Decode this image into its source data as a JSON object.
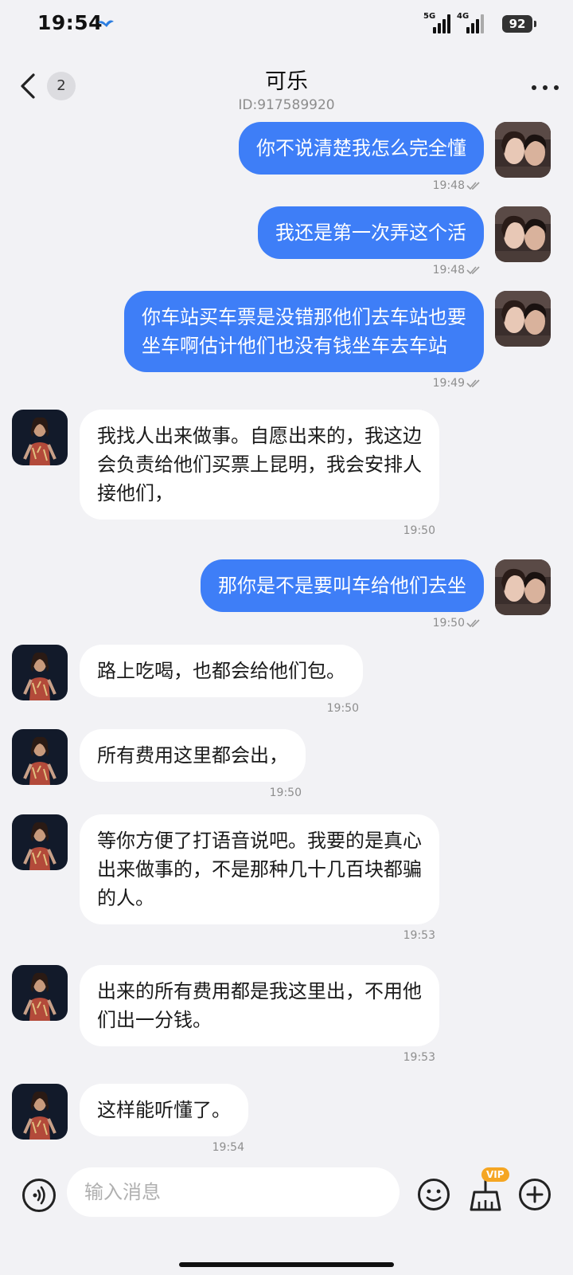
{
  "status_bar": {
    "time": "19:54",
    "network1": "5G",
    "network2": "4G",
    "battery": "92"
  },
  "header": {
    "back_badge": "2",
    "title": "可乐",
    "subtitle": "ID:917589920"
  },
  "messages": [
    {
      "side": "out",
      "text": "你不说清楚我怎么完全懂",
      "time": "19:48",
      "read": true
    },
    {
      "side": "out",
      "text": "我还是第一次弄这个活",
      "time": "19:48",
      "read": true
    },
    {
      "side": "out",
      "text": "你车站买车票是没错那他们去车站也要\n坐车啊估计他们也没有钱坐车去车站",
      "time": "19:49",
      "read": true
    },
    {
      "side": "in",
      "text": "我找人出来做事。自愿出来的，我这边\n会负责给他们买票上昆明，我会安排人\n接他们，",
      "time": "19:50"
    },
    {
      "side": "out",
      "text": "那你是不是要叫车给他们去坐",
      "time": "19:50",
      "read": true
    },
    {
      "side": "in",
      "text": "路上吃喝，也都会给他们包。",
      "time": "19:50"
    },
    {
      "side": "in",
      "text": "所有费用这里都会出，",
      "time": "19:50"
    },
    {
      "side": "in",
      "text": "等你方便了打语音说吧。我要的是真心\n出来做事的，不是那种几十几百块都骗\n的人。",
      "time": "19:53"
    },
    {
      "side": "in",
      "text": "出来的所有费用都是我这里出，不用他\n们出一分钱。",
      "time": "19:53"
    },
    {
      "side": "in",
      "text": "这样能听懂了。",
      "time": "19:54"
    }
  ],
  "input_bar": {
    "placeholder": "输入消息",
    "vip_label": "VIP"
  },
  "colors": {
    "outgoing_bubble": "#3e7ef7",
    "incoming_bubble": "#ffffff",
    "background": "#f2f2f5",
    "vip": "#f5a623"
  },
  "icons": [
    "back-chevron-icon",
    "more-dots-icon",
    "voice-icon",
    "emoji-icon",
    "broom-icon",
    "plus-icon",
    "read-check-icon"
  ]
}
